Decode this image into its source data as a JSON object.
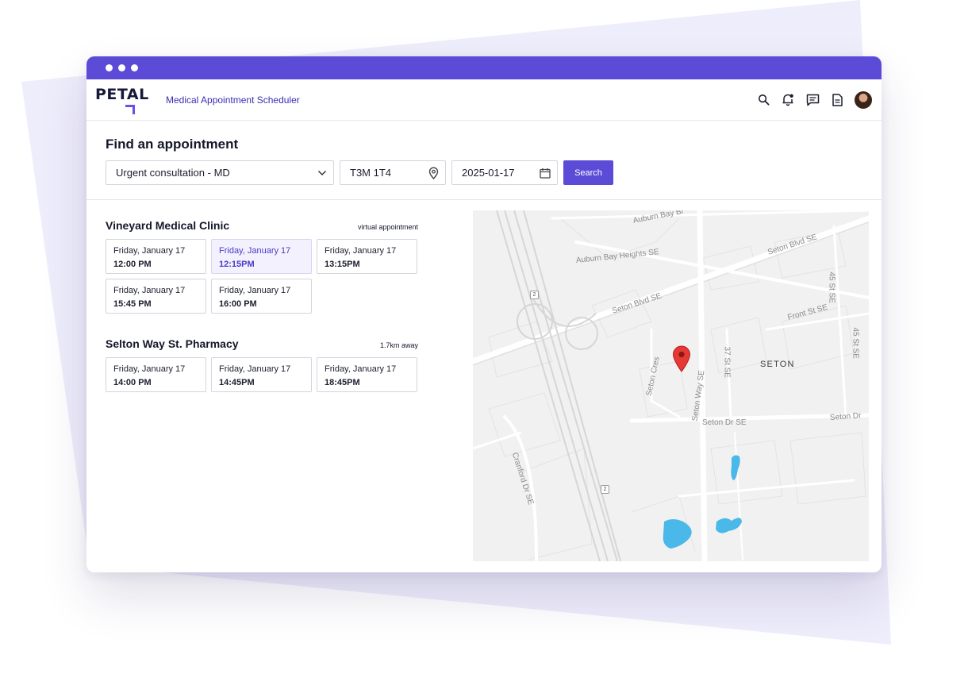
{
  "app": {
    "logo_text": "PETAL",
    "title": "Medical Appointment Scheduler"
  },
  "header_icons": [
    "search-icon",
    "bell-icon",
    "chat-icon",
    "document-icon",
    "avatar"
  ],
  "search": {
    "heading": "Find an appointment",
    "appointment_type": "Urgent consultation - MD",
    "postal_code": "T3M 1T4",
    "date": "2025-01-17",
    "button_label": "Search"
  },
  "clinics": [
    {
      "name": "Vineyard Medical Clinic",
      "tag": "virtual appointment",
      "slots": [
        {
          "day": "Friday, January 17",
          "time": "12:00 PM",
          "selected": false
        },
        {
          "day": "Friday, January 17",
          "time": "12:15PM",
          "selected": true
        },
        {
          "day": "Friday, January 17",
          "time": "13:15PM",
          "selected": false
        },
        {
          "day": "Friday, January 17",
          "time": "15:45 PM",
          "selected": false
        },
        {
          "day": "Friday, January 17",
          "time": "16:00 PM",
          "selected": false
        }
      ]
    },
    {
      "name": "Selton Way St. Pharmacy",
      "tag": "1.7km away",
      "slots": [
        {
          "day": "Friday, January 17",
          "time": "14:00 PM",
          "selected": false
        },
        {
          "day": "Friday, January 17",
          "time": "14:45PM",
          "selected": false
        },
        {
          "day": "Friday, January 17",
          "time": "18:45PM",
          "selected": false
        }
      ]
    }
  ],
  "map": {
    "labels": {
      "auburn_bay_blvd": "Auburn Bay Bl",
      "auburn_bay_heights": "Auburn Bay Heights SE",
      "seton_blvd_upper": "Seton Blvd SE",
      "seton_blvd_lower": "Seton Blvd SE",
      "st45_a": "45 St SE",
      "st45_b": "45 St SE",
      "front_st": "Front St SE",
      "st37": "37 St SE",
      "seton_cres": "Seton Cres",
      "seton_way": "Seton Way SE",
      "seton_area": "SETON",
      "seton_dr_mid": "Seton Dr SE",
      "seton_dr_right": "Seton Dr",
      "cranford_dr": "Cranford Dr SE",
      "hwy_a": "2",
      "hwy_b": "2"
    },
    "colors": {
      "water": "#4bb8ea",
      "pin": "#e53935",
      "roads": "#ffffff"
    }
  },
  "colors": {
    "brand": "#5b4bd6",
    "selected_slot_bg": "#f3f1fd"
  }
}
